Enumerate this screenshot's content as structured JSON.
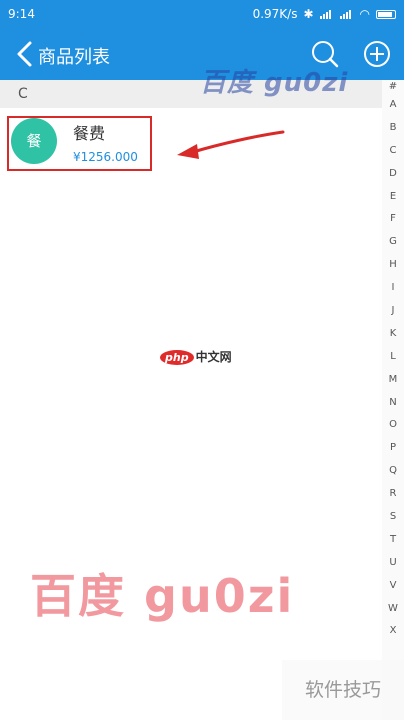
{
  "status_bar": {
    "time": "9:14",
    "speed": "0.97K/s"
  },
  "nav": {
    "title": "商品列表",
    "back_icon": "chevron-left-icon",
    "search_icon": "search-icon",
    "add_icon": "plus-circle-icon"
  },
  "section": {
    "header": "C"
  },
  "items": [
    {
      "avatar_text": "餐",
      "name": "餐费",
      "price": "¥1256.000"
    }
  ],
  "index_letters": [
    "#",
    "A",
    "B",
    "C",
    "D",
    "E",
    "F",
    "G",
    "H",
    "I",
    "J",
    "K",
    "L",
    "M",
    "N",
    "O",
    "P",
    "Q",
    "R",
    "S",
    "T",
    "U",
    "V",
    "W",
    "X"
  ],
  "watermarks": {
    "top": "百度 gu0zi",
    "bottom": "百度 gu0zi",
    "php_logo": "php",
    "php_cn": "中文网",
    "tip": "软件技巧"
  },
  "colors": {
    "brand": "#1f8fe0",
    "avatar": "#2fc2a5",
    "highlight": "#d92a2a"
  }
}
